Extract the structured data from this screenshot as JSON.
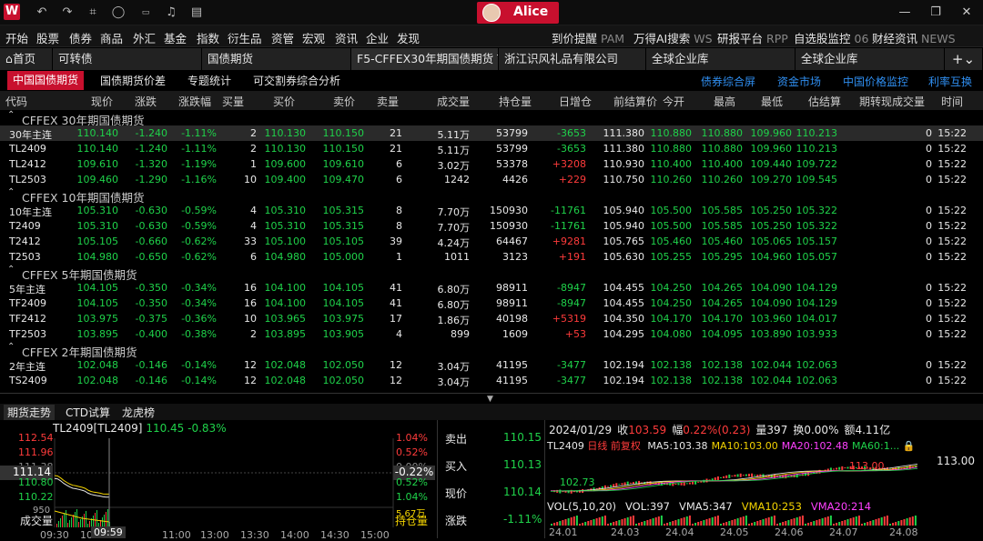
{
  "titlebar": {
    "logo": "W",
    "user": "Alice",
    "icons": [
      "back-icon",
      "forward-icon",
      "crop-icon",
      "chat-icon",
      "wps-icon",
      "bell-icon",
      "note-icon"
    ]
  },
  "menu": {
    "items": [
      "开始",
      "股票",
      "债券",
      "商品",
      "外汇",
      "基金",
      "指数",
      "衍生品",
      "资管",
      "宏观",
      "资讯",
      "企业",
      "发现"
    ],
    "right": [
      {
        "label": "到价提醒",
        "key": "PAM"
      },
      {
        "label": "万得AI搜索",
        "key": "WS"
      },
      {
        "label": "研报平台",
        "key": "RPP"
      },
      {
        "label": "自选股监控",
        "key": "06"
      },
      {
        "label": "财经资讯",
        "key": "NEWS"
      }
    ]
  },
  "tabs": [
    "首页",
    "可转债",
    "国债期货",
    "F5-CFFEX30年期国债期货 T",
    "浙江识风礼品有限公司",
    "全球企业库",
    "全球企业库"
  ],
  "subtabs": [
    "中国国债期货",
    "国债期货价差",
    "专题统计",
    "可交割券综合分析"
  ],
  "rightlinks": [
    "债券综合屏",
    "资金市场",
    "中国价格监控",
    "利率互换"
  ],
  "columns": [
    "代码",
    "现价",
    "涨跌",
    "涨跌幅",
    "买量",
    "买价",
    "卖价",
    "卖量",
    "成交量",
    "持仓量",
    "日增仓",
    "前结算价",
    "今开",
    "最高",
    "最低",
    "估结算",
    "期转现成交量",
    "时间"
  ],
  "groups": [
    {
      "name": "CFFEX 30年期国债期货",
      "rows": [
        [
          "30年主连",
          "110.140",
          "-1.240",
          "-1.11%",
          "2",
          "110.130",
          "110.150",
          "21",
          "5.11万",
          "53799",
          "-3653",
          "111.380",
          "110.880",
          "110.880",
          "109.960",
          "110.213",
          "0",
          "15:22"
        ],
        [
          "TL2409",
          "110.140",
          "-1.240",
          "-1.11%",
          "2",
          "110.130",
          "110.150",
          "21",
          "5.11万",
          "53799",
          "-3653",
          "111.380",
          "110.880",
          "110.880",
          "109.960",
          "110.213",
          "0",
          "15:22"
        ],
        [
          "TL2412",
          "109.610",
          "-1.320",
          "-1.19%",
          "1",
          "109.600",
          "109.610",
          "6",
          "3.02万",
          "53378",
          "+3208",
          "110.930",
          "110.400",
          "110.400",
          "109.440",
          "109.722",
          "0",
          "15:22"
        ],
        [
          "TL2503",
          "109.460",
          "-1.290",
          "-1.16%",
          "10",
          "109.400",
          "109.470",
          "6",
          "1242",
          "4426",
          "+229",
          "110.750",
          "110.260",
          "110.260",
          "109.270",
          "109.545",
          "0",
          "15:22"
        ]
      ]
    },
    {
      "name": "CFFEX 10年期国债期货",
      "rows": [
        [
          "10年主连",
          "105.310",
          "-0.630",
          "-0.59%",
          "4",
          "105.310",
          "105.315",
          "8",
          "7.70万",
          "150930",
          "-11761",
          "105.940",
          "105.500",
          "105.585",
          "105.250",
          "105.322",
          "0",
          "15:22"
        ],
        [
          "T2409",
          "105.310",
          "-0.630",
          "-0.59%",
          "4",
          "105.310",
          "105.315",
          "8",
          "7.70万",
          "150930",
          "-11761",
          "105.940",
          "105.500",
          "105.585",
          "105.250",
          "105.322",
          "0",
          "15:22"
        ],
        [
          "T2412",
          "105.105",
          "-0.660",
          "-0.62%",
          "33",
          "105.100",
          "105.105",
          "39",
          "4.24万",
          "64467",
          "+9281",
          "105.765",
          "105.460",
          "105.460",
          "105.065",
          "105.157",
          "0",
          "15:22"
        ],
        [
          "T2503",
          "104.980",
          "-0.650",
          "-0.62%",
          "6",
          "104.980",
          "105.000",
          "1",
          "1011",
          "3123",
          "+191",
          "105.630",
          "105.255",
          "105.295",
          "104.960",
          "105.057",
          "0",
          "15:22"
        ]
      ]
    },
    {
      "name": "CFFEX 5年期国债期货",
      "rows": [
        [
          "5年主连",
          "104.105",
          "-0.350",
          "-0.34%",
          "16",
          "104.100",
          "104.105",
          "41",
          "6.80万",
          "98911",
          "-8947",
          "104.455",
          "104.250",
          "104.265",
          "104.090",
          "104.129",
          "0",
          "15:22"
        ],
        [
          "TF2409",
          "104.105",
          "-0.350",
          "-0.34%",
          "16",
          "104.100",
          "104.105",
          "41",
          "6.80万",
          "98911",
          "-8947",
          "104.455",
          "104.250",
          "104.265",
          "104.090",
          "104.129",
          "0",
          "15:22"
        ],
        [
          "TF2412",
          "103.975",
          "-0.375",
          "-0.36%",
          "10",
          "103.965",
          "103.975",
          "17",
          "1.86万",
          "40198",
          "+5319",
          "104.350",
          "104.170",
          "104.170",
          "103.960",
          "104.017",
          "0",
          "15:22"
        ],
        [
          "TF2503",
          "103.895",
          "-0.400",
          "-0.38%",
          "2",
          "103.895",
          "103.905",
          "4",
          "899",
          "1609",
          "+53",
          "104.295",
          "104.080",
          "104.095",
          "103.890",
          "103.933",
          "0",
          "15:22"
        ]
      ]
    },
    {
      "name": "CFFEX 2年期国债期货",
      "rows": [
        [
          "2年主连",
          "102.048",
          "-0.146",
          "-0.14%",
          "12",
          "102.048",
          "102.050",
          "12",
          "3.04万",
          "41195",
          "-3477",
          "102.194",
          "102.138",
          "102.138",
          "102.044",
          "102.063",
          "0",
          "15:22"
        ],
        [
          "TS2409",
          "102.048",
          "-0.146",
          "-0.14%",
          "12",
          "102.048",
          "102.050",
          "12",
          "3.04万",
          "41195",
          "-3477",
          "102.194",
          "102.138",
          "102.138",
          "102.044",
          "102.063",
          "0",
          "15:22"
        ]
      ]
    }
  ],
  "bottom": {
    "tabs": [
      "期货走势",
      "CTD试算",
      "龙虎榜"
    ],
    "intraday": {
      "title": "TL2409[TL2409]",
      "price": "110.45",
      "pct": "-0.83%",
      "yleft": [
        "112.54",
        "111.96",
        "111.38",
        "111.14",
        "110.80",
        "110.22",
        "950"
      ],
      "yright": [
        "1.04%",
        "0.52%",
        "0.00%",
        "-0.22%",
        "0.52%",
        "1.04%",
        "5.67万"
      ],
      "volume_label": "成交量",
      "oi_label": "持仓量",
      "times": [
        "09:30",
        "10:00",
        "09:59",
        "11:00",
        "13:00",
        "13:30",
        "14:00",
        "14:30",
        "15:00"
      ],
      "price_series": [
        110.9,
        110.88,
        110.8,
        110.7,
        110.62,
        110.55,
        110.5,
        110.48,
        110.45,
        110.42,
        110.38,
        110.3,
        110.25,
        110.22,
        110.2,
        110.18,
        110.15,
        110.14,
        110.14
      ]
    },
    "quote": [
      {
        "label": "卖出",
        "value": "110.15"
      },
      {
        "label": "买入",
        "value": "110.13"
      },
      {
        "label": "现价",
        "value": "110.14"
      },
      {
        "label": "涨跌",
        "value": "-1.11%"
      }
    ],
    "kline": {
      "header": [
        {
          "text": "2024/01/29",
          "c": "#e8e8e8"
        },
        {
          "text": "收",
          "c": "#e8e8e8"
        },
        {
          "text": "103.59",
          "c": "#ff3b3b"
        },
        {
          "text": "幅",
          "c": "#e8e8e8"
        },
        {
          "text": "0.22%(0.23)",
          "c": "#ff3b3b"
        },
        {
          "text": "量",
          "c": "#e8e8e8"
        },
        {
          "text": "397",
          "c": "#e8e8e8"
        },
        {
          "text": "换",
          "c": "#e8e8e8"
        },
        {
          "text": "0.00%",
          "c": "#e8e8e8"
        },
        {
          "text": "额",
          "c": "#e8e8e8"
        },
        {
          "text": "4.11亿",
          "c": "#e8e8e8"
        }
      ],
      "code": "TL2409",
      "subtitle": "日线 前复权",
      "ma": [
        {
          "text": "MA5:103.38",
          "c": "#e8e8e8"
        },
        {
          "text": "MA10:103.00",
          "c": "#f3d300"
        },
        {
          "text": "MA20:102.48",
          "c": "#ff40ff"
        },
        {
          "text": "MA60:1...",
          "c": "#1fd24a"
        }
      ],
      "price_right": "113.00",
      "hi_mark": "113.00",
      "lo_mark": "102.73",
      "vol": [
        {
          "text": "VOL(5,10,20)",
          "c": "#e8e8e8"
        },
        {
          "text": "VOL:397",
          "c": "#e8e8e8"
        },
        {
          "text": "VMA5:347",
          "c": "#e8e8e8"
        },
        {
          "text": "VMA10:253",
          "c": "#f3d300"
        },
        {
          "text": "VMA20:214",
          "c": "#ff40ff"
        }
      ],
      "months": [
        "24.01",
        "24.03",
        "24.04",
        "24.05",
        "24.06",
        "24.07",
        "24.08"
      ]
    }
  }
}
